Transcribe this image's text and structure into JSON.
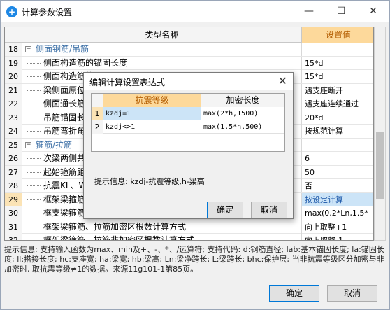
{
  "window": {
    "title": "计算参数设置",
    "minimize": "—",
    "maximize": "☐",
    "close": "✕"
  },
  "grid": {
    "col_name": "类型名称",
    "col_value": "设置值",
    "rows": [
      {
        "num": "18",
        "name": "侧面钢筋/吊筋",
        "value": "",
        "group": true
      },
      {
        "num": "19",
        "name": "侧面构造筋的锚固长度",
        "value": "15*d"
      },
      {
        "num": "20",
        "name": "侧面构造筋的",
        "value": "15*d"
      },
      {
        "num": "21",
        "name": "梁侧面原位标",
        "value": "遇支座断开"
      },
      {
        "num": "22",
        "name": "侧面通长筋遇",
        "value": "遇支座连续通过"
      },
      {
        "num": "23",
        "name": "吊筋锚固长度",
        "value": "20*d"
      },
      {
        "num": "24",
        "name": "吊筋弯折角度",
        "value": "按规范计算"
      },
      {
        "num": "25",
        "name": "箍筋/拉筋",
        "value": "",
        "group": true
      },
      {
        "num": "26",
        "name": "次梁两侧共增",
        "value": "6"
      },
      {
        "num": "27",
        "name": "起始箍筋距支",
        "value": "50"
      },
      {
        "num": "28",
        "name": "抗震KL、WKL",
        "value": "否"
      },
      {
        "num": "29",
        "name": "框架梁箍筋加",
        "value": "按设定计算",
        "hl": true
      },
      {
        "num": "30",
        "name": "框支梁箍筋加",
        "value": "max(0.2*Ln,1.5*"
      },
      {
        "num": "31",
        "name": "框架梁箍筋、拉筋加密区根数计算方式",
        "value": "向上取整+1"
      },
      {
        "num": "32",
        "name": "框架梁箍筋、拉筋非加密区根数计算方式",
        "value": "向上取整-1"
      }
    ]
  },
  "info": {
    "text": "提示信息: 支持输入函数为max、min及+、-、*、/运算符; 支持代码: d:钢筋直径; lab:基本锚固长度; la:锚固长度; ll:搭接长度; hc:支座宽; ha:梁宽; hb:梁高; Ln:梁净跨长; L:梁跨长; bhc:保护层; 当非抗震等级区分加密与非加密时, 取抗震等级≠1的数据。来源11g101-1第85页。"
  },
  "buttons": {
    "ok": "确定",
    "cancel": "取消"
  },
  "dialog": {
    "title": "编辑计算设置表达式",
    "close": "✕",
    "col_cond": "抗震等级",
    "col_len": "加密长度",
    "rows": [
      {
        "num": "1",
        "cond": "kzdj=1",
        "len": "max(2*h,1500)",
        "sel": true
      },
      {
        "num": "2",
        "cond": "kzdj<>1",
        "len": "max(1.5*h,500)"
      }
    ],
    "hint": "提示信息: kzdj-抗震等级,h-梁高",
    "ok": "确定",
    "cancel": "取消"
  }
}
